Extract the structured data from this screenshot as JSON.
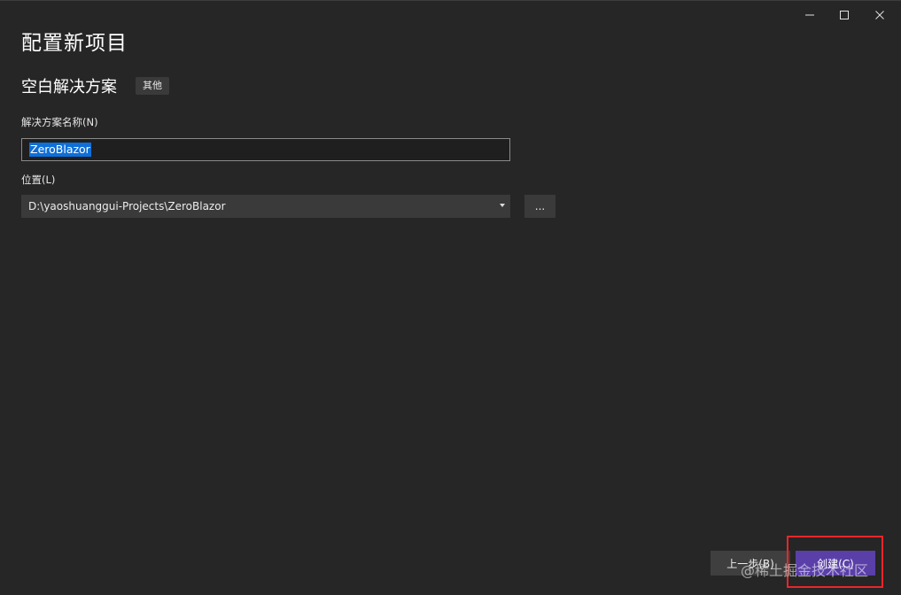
{
  "window": {
    "controls": {
      "minimize_icon": "minimize-icon",
      "maximize_icon": "maximize-icon",
      "close_icon": "close-icon"
    }
  },
  "header": {
    "title": "配置新项目",
    "template_name": "空白解决方案",
    "template_tag": "其他"
  },
  "form": {
    "solution_name": {
      "label": "解决方案名称(N)",
      "value": "ZeroBlazor"
    },
    "location": {
      "label": "位置(L)",
      "value": "D:\\yaoshuanggui-Projects\\ZeroBlazor",
      "browse_label": "..."
    }
  },
  "footer": {
    "back_label": "上一步(B)",
    "create_label": "创建(C)"
  },
  "watermark": "@稀土掘金技术社区",
  "colors": {
    "background": "#262626",
    "accent": "#5a3fa8",
    "selection": "#0e6fd8",
    "highlight": "#e8262b"
  }
}
